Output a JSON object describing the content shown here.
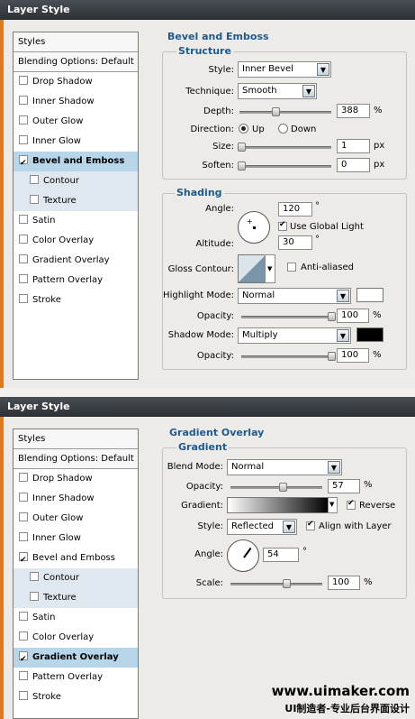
{
  "top": {
    "title": "Layer Style",
    "styles_header": "Styles",
    "blending": "Blending Options: Default",
    "items": [
      {
        "label": "Drop Shadow",
        "checked": false
      },
      {
        "label": "Inner Shadow",
        "checked": false
      },
      {
        "label": "Outer Glow",
        "checked": false
      },
      {
        "label": "Inner Glow",
        "checked": false
      },
      {
        "label": "Bevel and Emboss",
        "checked": true
      },
      {
        "label": "Contour",
        "checked": false
      },
      {
        "label": "Texture",
        "checked": false
      },
      {
        "label": "Satin",
        "checked": false
      },
      {
        "label": "Color Overlay",
        "checked": false
      },
      {
        "label": "Gradient Overlay",
        "checked": false
      },
      {
        "label": "Pattern Overlay",
        "checked": false
      },
      {
        "label": "Stroke",
        "checked": false
      }
    ],
    "section_title": "Bevel and Emboss",
    "structure": {
      "title": "Structure",
      "style_label": "Style:",
      "style_value": "Inner Bevel",
      "technique_label": "Technique:",
      "technique_value": "Smooth",
      "depth_label": "Depth:",
      "depth_value": "388",
      "depth_unit": "%",
      "direction_label": "Direction:",
      "up_label": "Up",
      "down_label": "Down",
      "size_label": "Size:",
      "size_value": "1",
      "size_unit": "px",
      "soften_label": "Soften:",
      "soften_value": "0",
      "soften_unit": "px"
    },
    "shading": {
      "title": "Shading",
      "angle_label": "Angle:",
      "angle_value": "120",
      "deg": "°",
      "global_light_label": "Use Global Light",
      "altitude_label": "Altitude:",
      "altitude_value": "30",
      "gloss_label": "Gloss Contour:",
      "antialiased_label": "Anti-aliased",
      "highlight_label": "Highlight Mode:",
      "highlight_value": "Normal",
      "opacity_label": "Opacity:",
      "highlight_opacity": "100",
      "pct": "%",
      "shadow_label": "Shadow Mode:",
      "shadow_value": "Multiply",
      "shadow_opacity": "100",
      "highlight_color": "#ffffff",
      "shadow_color": "#000000"
    }
  },
  "bottom": {
    "title": "Layer Style",
    "styles_header": "Styles",
    "blending": "Blending Options: Default",
    "items": [
      {
        "label": "Drop Shadow",
        "checked": false
      },
      {
        "label": "Inner Shadow",
        "checked": false
      },
      {
        "label": "Outer Glow",
        "checked": false
      },
      {
        "label": "Inner Glow",
        "checked": false
      },
      {
        "label": "Bevel and Emboss",
        "checked": true
      },
      {
        "label": "Contour",
        "checked": false
      },
      {
        "label": "Texture",
        "checked": false
      },
      {
        "label": "Satin",
        "checked": false
      },
      {
        "label": "Color Overlay",
        "checked": false
      },
      {
        "label": "Gradient Overlay",
        "checked": true
      },
      {
        "label": "Pattern Overlay",
        "checked": false
      },
      {
        "label": "Stroke",
        "checked": false
      }
    ],
    "section_title": "Gradient Overlay",
    "gradient": {
      "title": "Gradient",
      "blend_label": "Blend Mode:",
      "blend_value": "Normal",
      "opacity_label": "Opacity:",
      "opacity_value": "57",
      "pct": "%",
      "gradient_label": "Gradient:",
      "reverse_label": "Reverse",
      "style_label": "Style:",
      "style_value": "Reflected",
      "align_label": "Align with Layer",
      "angle_label": "Angle:",
      "angle_value": "54",
      "deg": "°",
      "scale_label": "Scale:",
      "scale_value": "100"
    }
  },
  "watermark": {
    "site": "www.uimaker.com",
    "tagline": "UI制造者-专业后台界面设计"
  }
}
